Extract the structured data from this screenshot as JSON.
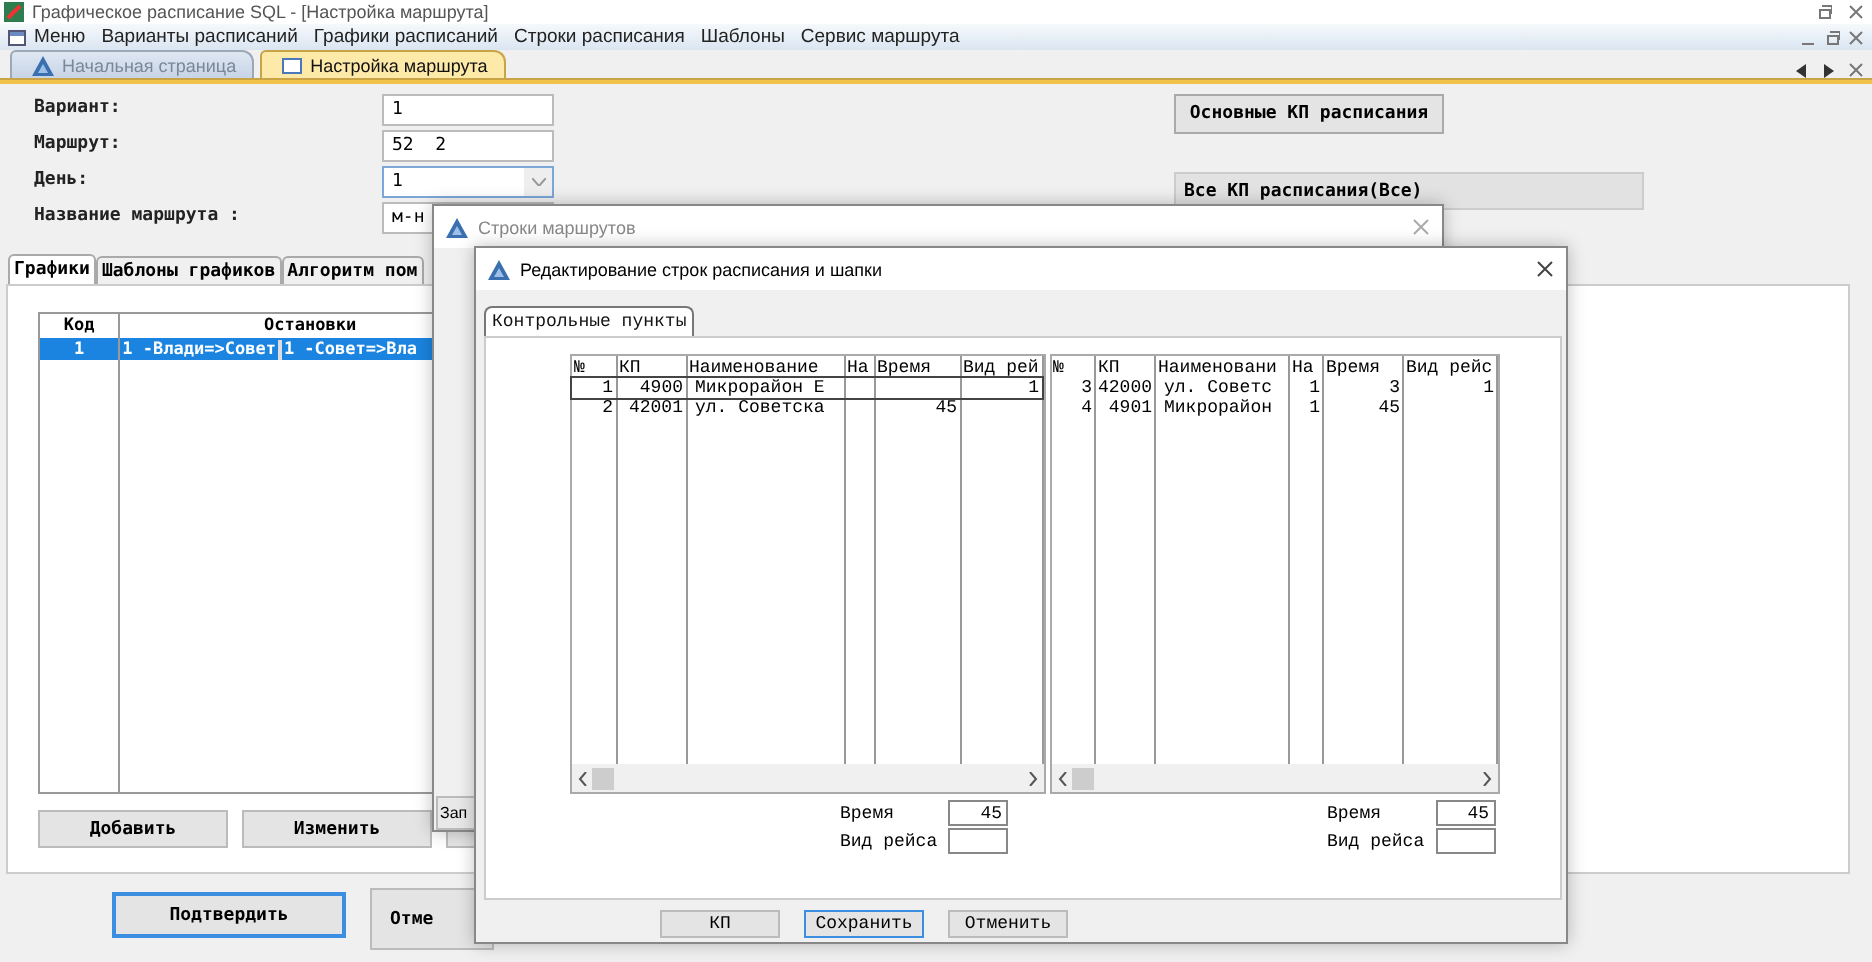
{
  "window": {
    "title": "Графическое расписание SQL - [Настройка маршрута]"
  },
  "menu": [
    "Меню",
    "Варианты расписаний",
    "Графики расписаний",
    "Строки расписания",
    "Шаблоны",
    "Сервис маршрута"
  ],
  "doc_tabs": [
    {
      "label": "Начальная страница",
      "selected": false
    },
    {
      "label": "Настройка маршрута",
      "selected": true
    }
  ],
  "form": {
    "fields": [
      {
        "label": "Вариант:",
        "value": "1",
        "kind": "text"
      },
      {
        "label": "Маршрут:",
        "value": "52  2",
        "kind": "text"
      },
      {
        "label": "День:",
        "value": "1",
        "kind": "dropdown"
      },
      {
        "label": "Название маршрута :",
        "value": "м-н",
        "kind": "text"
      }
    ],
    "main_kp_button": "Основные КП расписания",
    "all_kp_label": "Все КП расписания(Все)"
  },
  "inner_tabs": [
    {
      "label": "Графики",
      "selected": true
    },
    {
      "label": "Шаблоны графиков",
      "selected": false
    },
    {
      "label": "Алгоритм пом",
      "selected": false
    }
  ],
  "schedule_table": {
    "columns": [
      "Код",
      "Остановки"
    ],
    "rows": [
      {
        "code": "1",
        "stops": [
          "1 -Влади=>Совет",
          "1 -Совет=>Вла"
        ],
        "selected": true
      }
    ]
  },
  "panel_buttons": [
    "Добавить",
    "Изменить"
  ],
  "footer_buttons": [
    {
      "label": "Подтвердить",
      "focused": true
    },
    {
      "label": "Отме",
      "focused": false
    }
  ],
  "dialog_routes": {
    "title": "Строки маршрутов",
    "button": "Зап"
  },
  "dialog_edit": {
    "title": "Редактирование строк расписания и шапки",
    "tabs": [
      {
        "label": "Контрольные пункты",
        "selected": true
      }
    ],
    "grids": [
      {
        "columns": [
          "№",
          "КП",
          "Наименование",
          "На",
          "Время",
          "Вид рей"
        ],
        "rows": [
          {
            "no": "1",
            "kp": "4900",
            "name": "Микрорайон Е",
            "trip": "1",
            "selected": true
          },
          {
            "no": "2",
            "kp": "42001",
            "name": "ул. Советска",
            "time": "45",
            "selected": false
          }
        ],
        "time_label": "Время",
        "time_value": "45",
        "trip_label": "Вид рейса"
      },
      {
        "columns": [
          "№",
          "КП",
          "Наименовани",
          "На",
          "Время",
          "Вид рейс"
        ],
        "rows": [
          {
            "no": "3",
            "kp": "42000",
            "name": "ул. Советс",
            "na": "1",
            "time": "3",
            "trip": "1",
            "selected": false
          },
          {
            "no": "4",
            "kp": "4901",
            "name": "Микрорайон",
            "na": "1",
            "time": "45",
            "selected": false
          }
        ],
        "time_label": "Время",
        "time_value": "45",
        "trip_label": "Вид рейса"
      }
    ],
    "buttons": [
      {
        "label": "КП",
        "focused": false
      },
      {
        "label": "Сохранить",
        "focused": true
      },
      {
        "label": "Отменить",
        "focused": false
      }
    ]
  }
}
